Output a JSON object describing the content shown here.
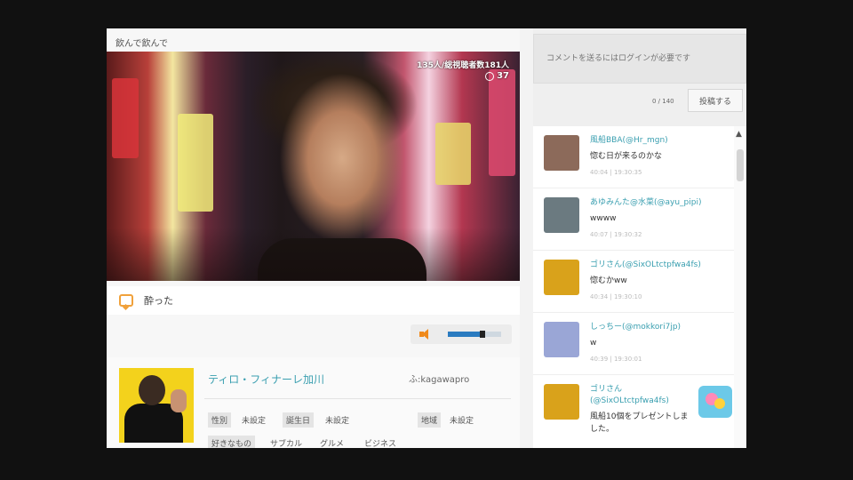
{
  "stream": {
    "title": "飲んで飲んで",
    "viewer_text": "135人/総視聴者数181人",
    "viewer_count": "37",
    "caption": "酔った"
  },
  "profile": {
    "name": "ティロ・フィナーレ加川",
    "id": "ふ:kagawapro",
    "gender_label": "性別",
    "gender_value": "未設定",
    "birthday_label": "誕生日",
    "birthday_value": "未設定",
    "region_label": "地域",
    "region_value": "未設定",
    "likes_label": "好きなもの",
    "likes": [
      "サブカル",
      "グルメ",
      "ビジネス"
    ]
  },
  "comment_input": {
    "placeholder": "コメントを送るにはログインが必要です",
    "char_count": "0 / 140",
    "post_label": "投稿する"
  },
  "feed": [
    {
      "user": "風船BBA(@Hr_mgn)",
      "msg": "惚む日が来るのかな",
      "time": "40:04 | 19:30:35",
      "color": "#8c6a5a"
    },
    {
      "user": "あゆみんた@水菜(@ayu_pipi)",
      "msg": "wwww",
      "time": "40:07 | 19:30:32",
      "color": "#6b7a80"
    },
    {
      "user": "ゴリさん(@SixOLtctpfwa4fs)",
      "msg": "惚むかww",
      "time": "40:34 | 19:30:10",
      "color": "#d9a21b"
    },
    {
      "user": "しっちー(@mokkori7jp)",
      "msg": "w",
      "time": "40:39 | 19:30:01",
      "color": "#9aa6d6"
    },
    {
      "user": "ゴリさん(@SixOLtctpfwa4fs)",
      "msg": "風船10個をプレゼントしました。",
      "time": "",
      "color": "#d9a21b"
    }
  ]
}
